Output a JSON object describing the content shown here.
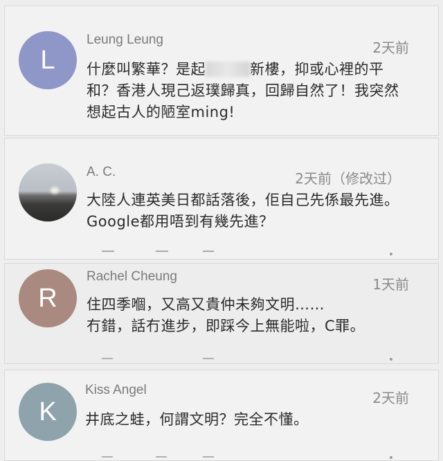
{
  "colors": {
    "avatar_l": "#8f97c8",
    "avatar_r": "#aa8a80",
    "avatar_k": "#8fa3ad"
  },
  "comments": [
    {
      "author": "Leung Leung",
      "avatar_letter": "L",
      "time": "2天前",
      "text_before_blur": "什麼叫繁華？是起",
      "text_after_blur": "新樓，抑或心裡的平和？香港人現己返璞歸真，回歸自然了！我突然想起古人的陋室ming!"
    },
    {
      "author": "A. C.",
      "avatar_icon": "landscape-photo-avatar",
      "time": "2天前（修改过）",
      "text": "大陸人連英美日都話落後，佢自己先係最先進。Google都用唔到有幾先進？"
    },
    {
      "author": "Rachel Cheung",
      "avatar_letter": "R",
      "time": "1天前",
      "text_line1": "住四季嗰，又高又貴仲未夠文明……",
      "text_line2": "冇錯，話冇進步，即踩今上無能啦，C罪。"
    },
    {
      "author": "Kiss Angel",
      "avatar_letter": "K",
      "time": "2天前",
      "text": "井底之蛙，何謂文明？完全不懂。"
    }
  ]
}
